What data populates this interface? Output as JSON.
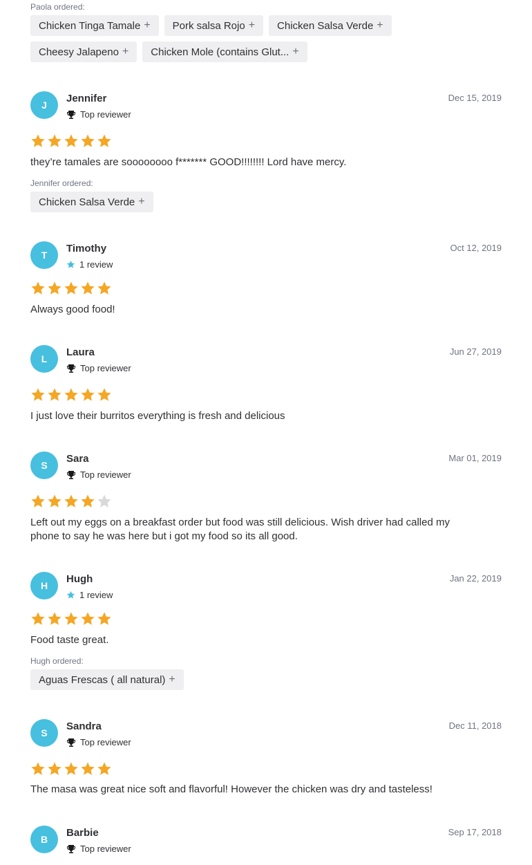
{
  "paola": {
    "ordered_label": "Paola ordered:",
    "items": [
      "Chicken Tinga Tamale",
      "Pork salsa Rojo",
      "Chicken Salsa Verde",
      "Cheesy Jalapeno",
      "Chicken Mole (contains Glut..."
    ]
  },
  "plus_symbol": "+",
  "colors": {
    "avatar": "#47bfdf",
    "star_filled": "#f5a623",
    "star_empty": "#d9d9d9",
    "chip_bg": "#efeff1"
  },
  "reviews": [
    {
      "initial": "J",
      "name": "Jennifer",
      "badge_icon": "trophy-icon",
      "badge": "Top reviewer",
      "date": "Dec 15, 2019",
      "rating": 5,
      "text": "they’re tamales are soooooooo f******* GOOD!!!!!!!! Lord have mercy.",
      "ordered_label": "Jennifer ordered:",
      "items": [
        "Chicken Salsa Verde"
      ]
    },
    {
      "initial": "T",
      "name": "Timothy",
      "badge_icon": "star-icon",
      "badge": "1 review",
      "date": "Oct 12, 2019",
      "rating": 5,
      "text": "Always good food!"
    },
    {
      "initial": "L",
      "name": "Laura",
      "badge_icon": "trophy-icon",
      "badge": "Top reviewer",
      "date": "Jun 27, 2019",
      "rating": 5,
      "text": "I just love their burritos everything is fresh and delicious"
    },
    {
      "initial": "S",
      "name": "Sara",
      "badge_icon": "trophy-icon",
      "badge": "Top reviewer",
      "date": "Mar 01, 2019",
      "rating": 4,
      "text": "Left out my eggs on a breakfast order but food was still delicious. Wish driver had called my phone to say he was here but i got my food so its all good."
    },
    {
      "initial": "H",
      "name": "Hugh",
      "badge_icon": "star-icon",
      "badge": "1 review",
      "date": "Jan 22, 2019",
      "rating": 5,
      "text": "Food taste great.",
      "ordered_label": "Hugh ordered:",
      "items": [
        "Aguas Frescas ( all natural)"
      ]
    },
    {
      "initial": "S",
      "name": "Sandra",
      "badge_icon": "trophy-icon",
      "badge": "Top reviewer",
      "date": "Dec 11, 2018",
      "rating": 5,
      "text": "The masa was great nice soft and flavorful! However the chicken was dry and tasteless!"
    },
    {
      "initial": "B",
      "name": "Barbie",
      "badge_icon": "trophy-icon",
      "badge": "Top reviewer",
      "date": "Sep 17, 2018",
      "rating": null
    }
  ]
}
